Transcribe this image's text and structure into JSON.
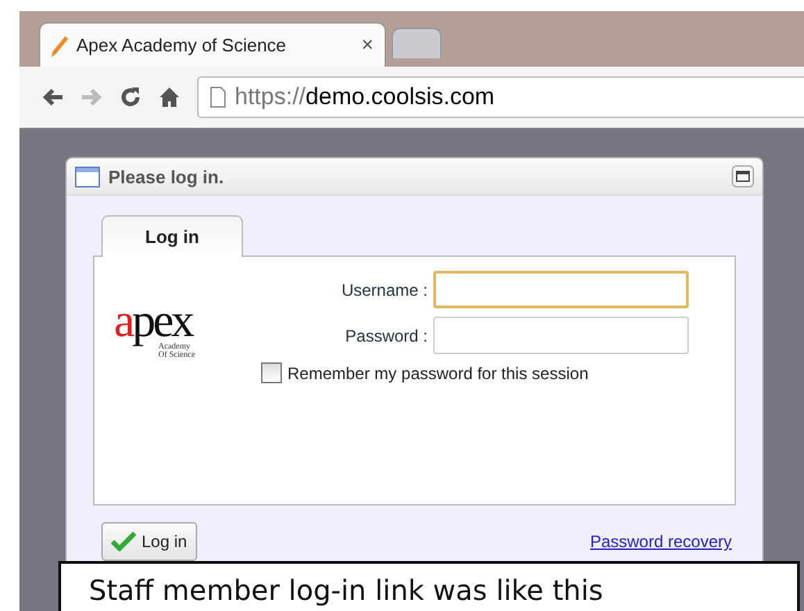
{
  "browser": {
    "tabs": [
      {
        "title": "Apex Academy of Science",
        "selected": true
      },
      {
        "selected": false
      }
    ],
    "tab_close": "×",
    "address": {
      "scheme": "https://",
      "host": "demo.coolsis.com"
    },
    "forward_disabled": true
  },
  "dialog": {
    "title": "Please log in.",
    "tabs": [
      {
        "label": "Log in",
        "selected": true
      }
    ],
    "logo": {
      "text": "apex",
      "subtitle": "Academy Of Science"
    },
    "fields": [
      {
        "label": "Username :",
        "focused": true
      },
      {
        "label": "Password :",
        "focused": false
      }
    ],
    "remember": {
      "label": "Remember my password for this session",
      "checked": false
    },
    "login_button": "Log in",
    "recovery_link": "Password recovery"
  },
  "callout": {
    "text": "Staff member log-in link was like this"
  }
}
